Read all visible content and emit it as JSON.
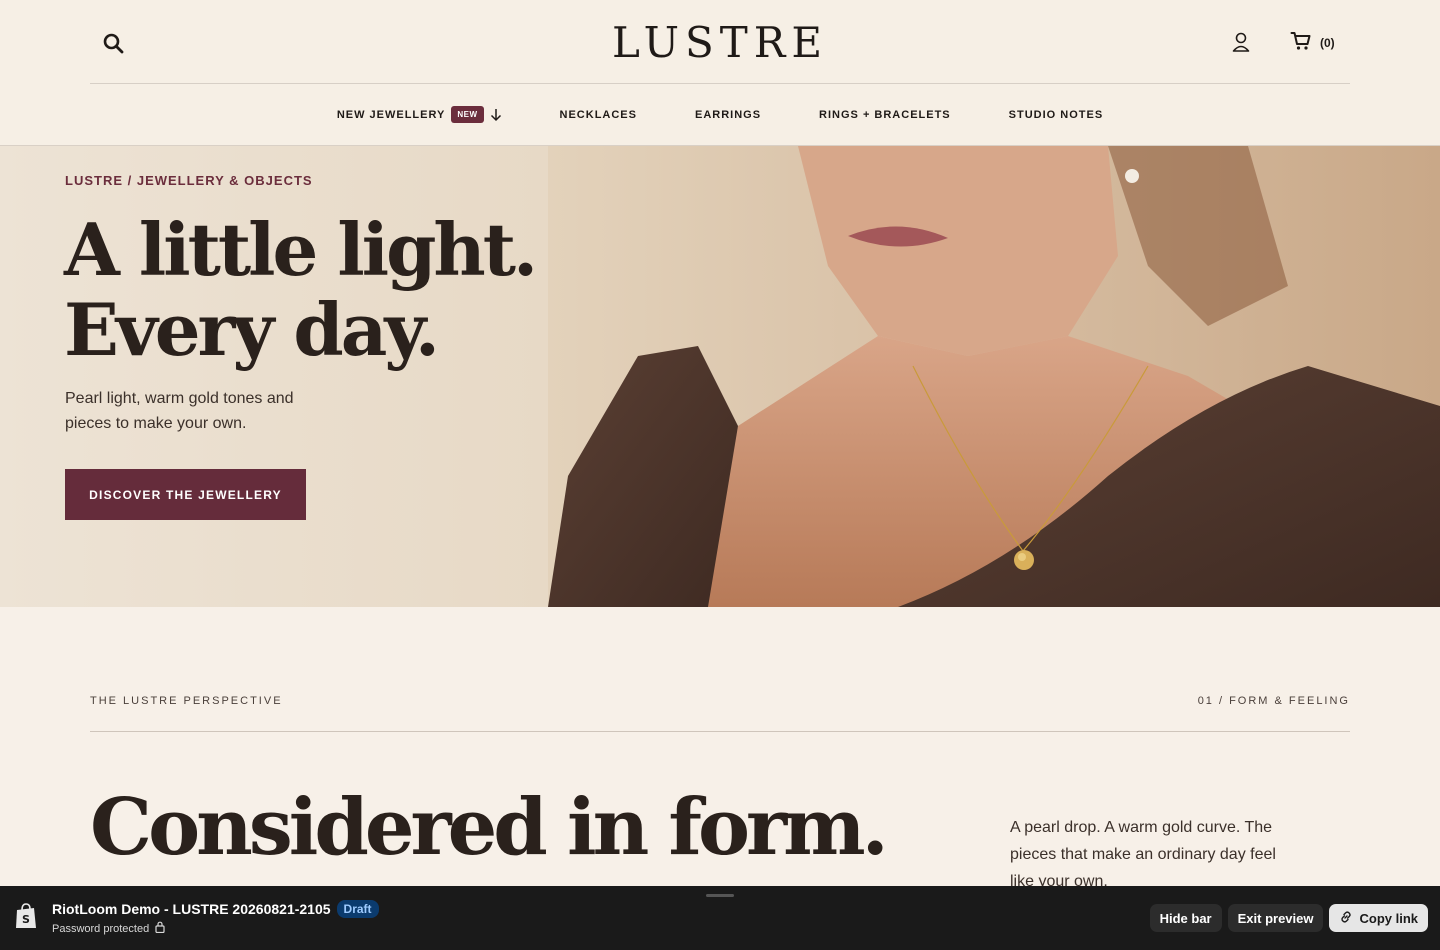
{
  "header": {
    "logo": "LUSTRE",
    "cart_count": "(0)",
    "icons": {
      "search": "search-icon",
      "account": "user-icon",
      "cart": "cart-icon"
    }
  },
  "nav": {
    "items": [
      {
        "label": "NEW JEWELLERY",
        "badge": "NEW",
        "has_dropdown": true
      },
      {
        "label": "NECKLACES"
      },
      {
        "label": "EARRINGS"
      },
      {
        "label": "RINGS + BRACELETS"
      },
      {
        "label": "STUDIO NOTES"
      }
    ]
  },
  "hero": {
    "eyebrow": "LUSTRE / JEWELLERY & OBJECTS",
    "title_line1": "A little light.",
    "title_line2": "Every day.",
    "copy": "Pearl light, warm gold tones and pieces to make your own.",
    "cta": "DISCOVER THE JEWELLERY"
  },
  "perspective": {
    "eyebrow": "THE LUSTRE PERSPECTIVE",
    "index": "01 / FORM & FEELING",
    "title": "Considered in form.",
    "copy": "A pearl drop. A warm gold curve. The pieces that make an ordinary day feel like your own."
  },
  "preview_bar": {
    "store_name": "RiotLoom Demo - LUSTRE 20260821-2105",
    "status": "Draft",
    "password_text": "Password protected",
    "hide_bar": "Hide bar",
    "exit_preview": "Exit preview",
    "copy_link": "Copy link"
  },
  "colors": {
    "accent": "#652c3b",
    "background": "#f7f0e8",
    "text": "#2a211c",
    "bar": "#1a1a1a"
  }
}
